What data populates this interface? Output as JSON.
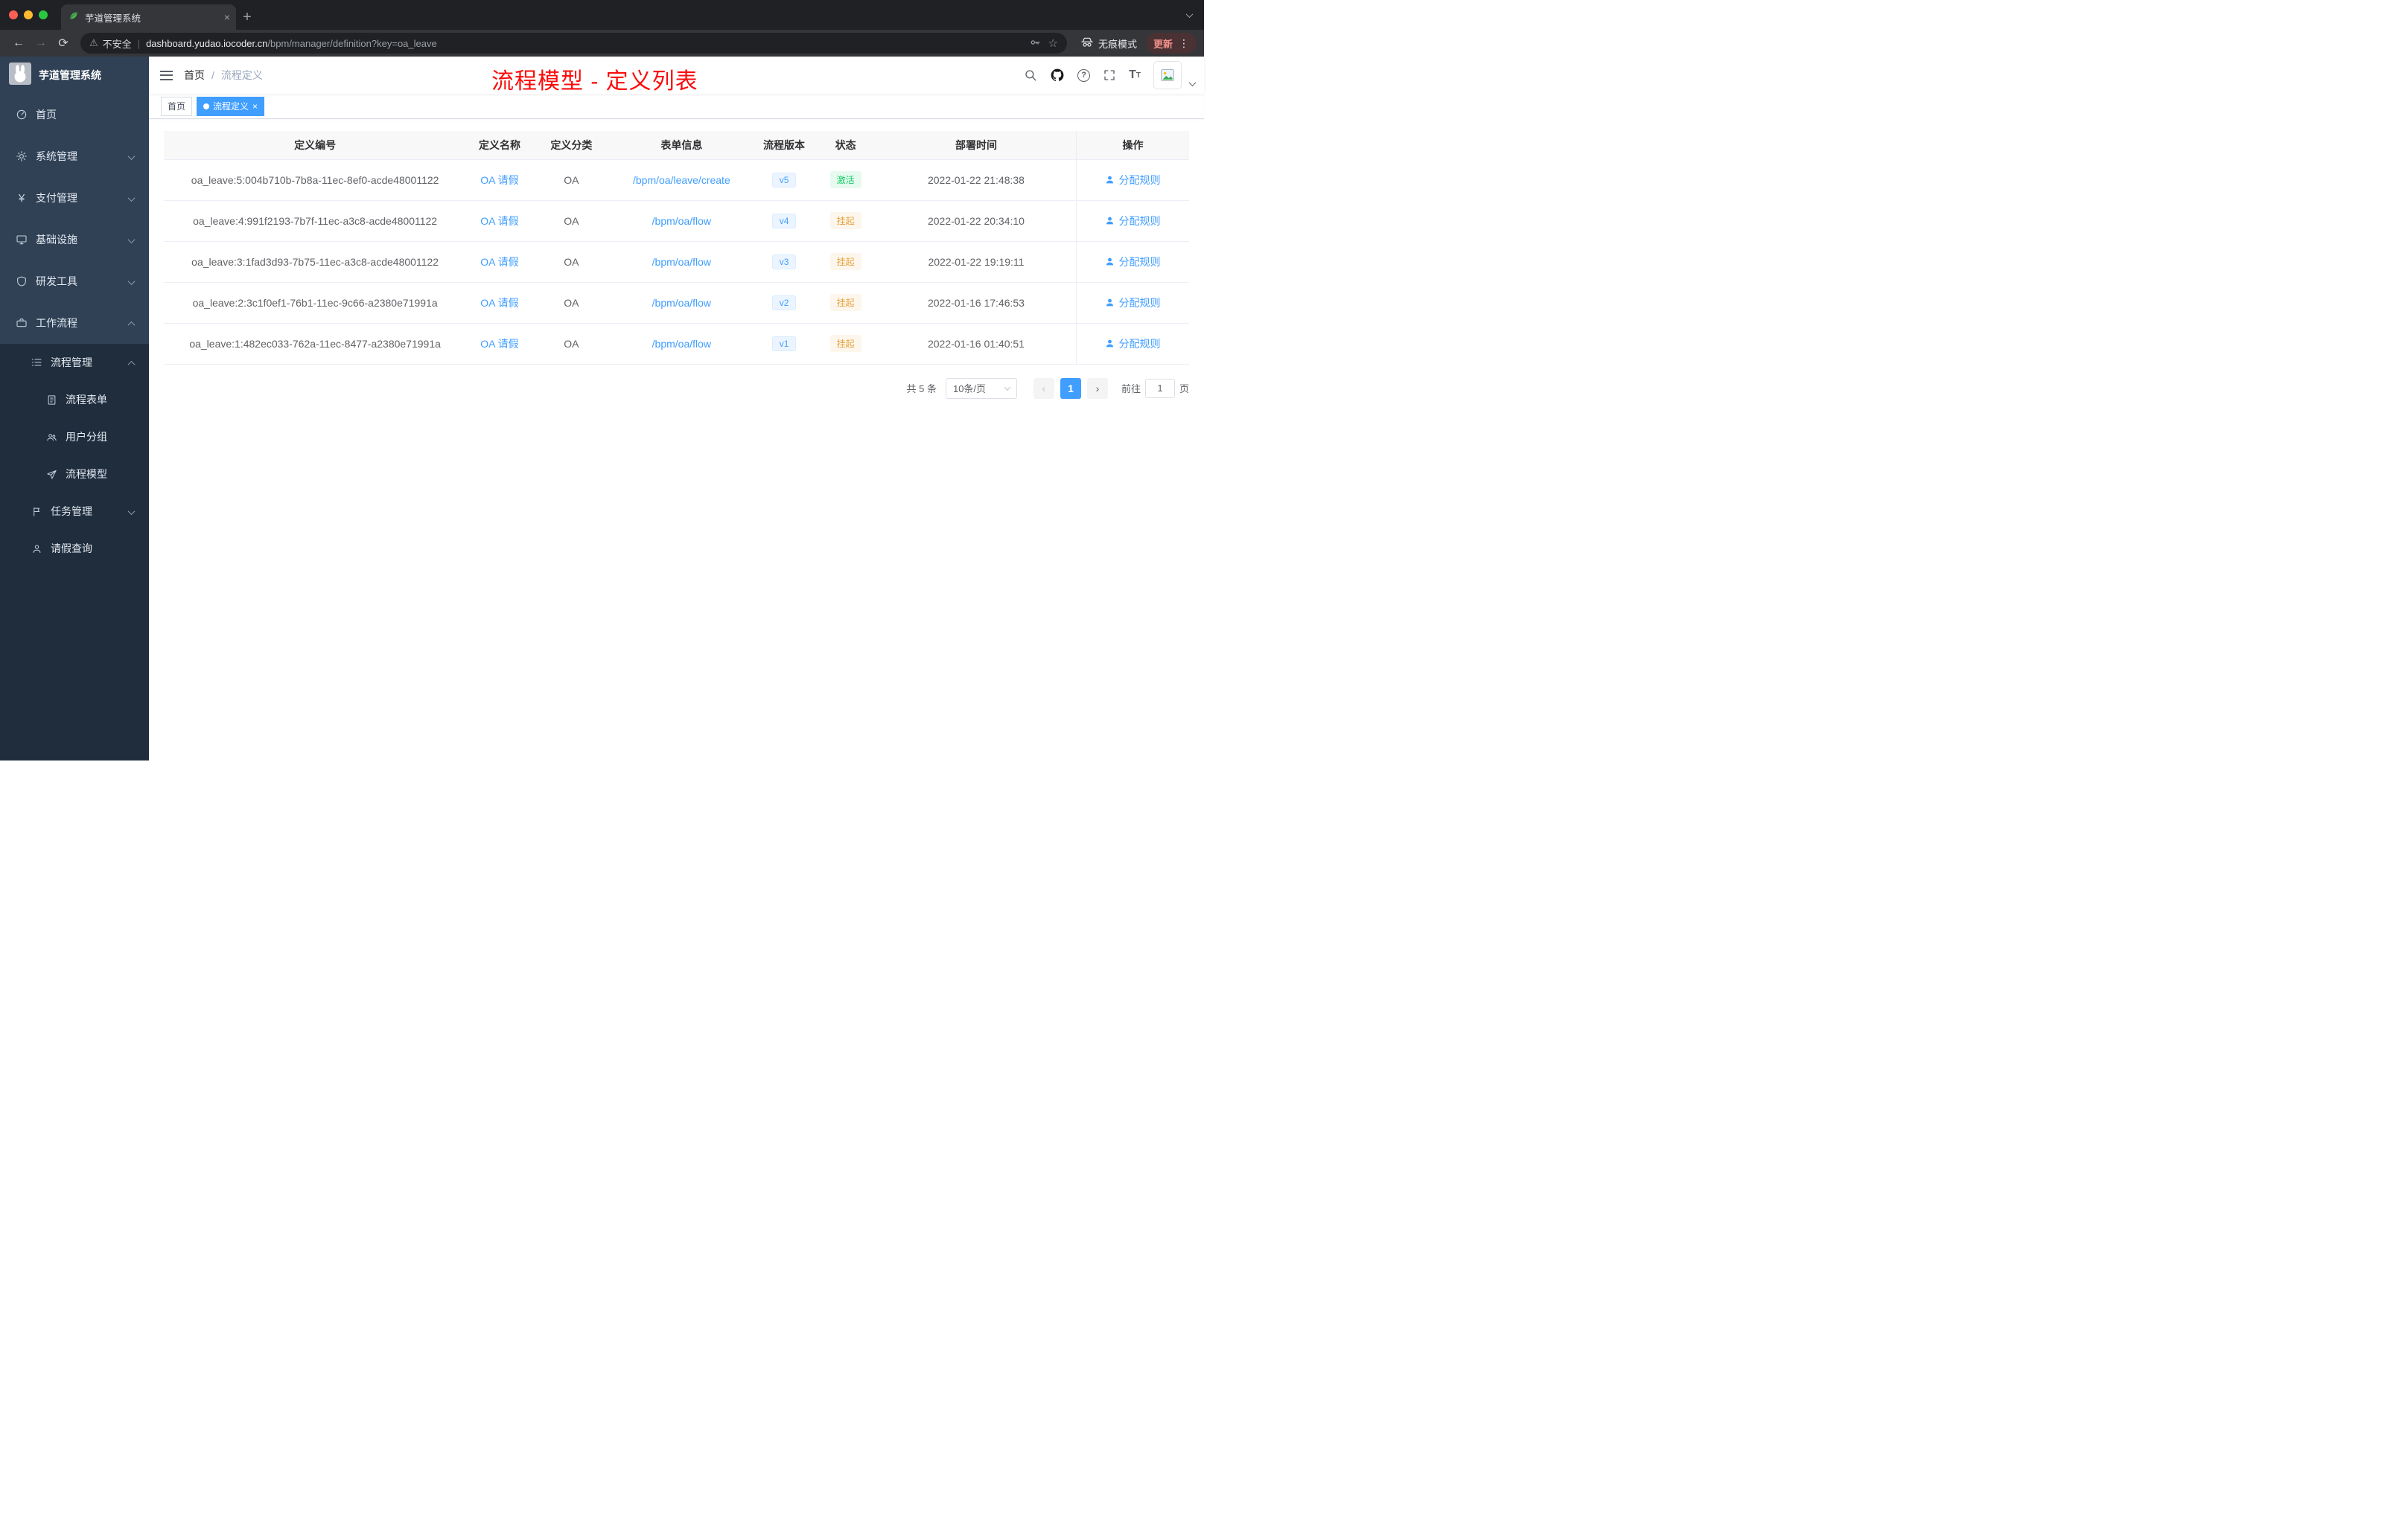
{
  "browser": {
    "tab_title": "芋道管理系统",
    "new_tab_icon": "+",
    "close_icon": "×",
    "back_icon": "←",
    "forward_icon": "→",
    "reload_icon": "⟳",
    "warning_icon": "⚠",
    "security_label": "不安全",
    "url_domain": "dashboard.yudao.iocoder.cn",
    "url_path": "/bpm/manager/definition?key=oa_leave",
    "star_icon": "☆",
    "incognito_label": "无痕模式",
    "update_label": "更新",
    "menu_icon": "⋮"
  },
  "sidebar": {
    "app_title": "芋道管理系统",
    "menu": [
      {
        "label": "首页"
      },
      {
        "label": "系统管理"
      },
      {
        "label": "支付管理"
      },
      {
        "label": "基础设施"
      },
      {
        "label": "研发工具"
      },
      {
        "label": "工作流程"
      },
      {
        "label": "流程管理"
      },
      {
        "label": "流程表单"
      },
      {
        "label": "用户分组"
      },
      {
        "label": "流程模型"
      },
      {
        "label": "任务管理"
      },
      {
        "label": "请假查询"
      }
    ]
  },
  "navbar": {
    "breadcrumb_home": "首页",
    "breadcrumb_sep": "/",
    "breadcrumb_current": "流程定义",
    "annotation": "流程模型 - 定义列表"
  },
  "tags": {
    "home": "首页",
    "active": "流程定义",
    "close_icon": "×"
  },
  "table": {
    "columns": [
      "定义编号",
      "定义名称",
      "定义分类",
      "表单信息",
      "流程版本",
      "状态",
      "部署时间",
      "操作"
    ],
    "rows": [
      {
        "id": "oa_leave:5:004b710b-7b8a-11ec-8ef0-acde48001122",
        "name": "OA 请假",
        "category": "OA",
        "form": "/bpm/oa/leave/create",
        "version": "v5",
        "status": "激活",
        "status_color": "#13ce66",
        "time": "2022-01-22 21:48:38",
        "action": "分配规则"
      },
      {
        "id": "oa_leave:4:991f2193-7b7f-11ec-a3c8-acde48001122",
        "name": "OA 请假",
        "category": "OA",
        "form": "/bpm/oa/flow",
        "version": "v4",
        "status": "挂起",
        "status_color": "#e6a23c",
        "time": "2022-01-22 20:34:10",
        "action": "分配规则"
      },
      {
        "id": "oa_leave:3:1fad3d93-7b75-11ec-a3c8-acde48001122",
        "name": "OA 请假",
        "category": "OA",
        "form": "/bpm/oa/flow",
        "version": "v3",
        "status": "挂起",
        "status_color": "#e6a23c",
        "time": "2022-01-22 19:19:11",
        "action": "分配规则"
      },
      {
        "id": "oa_leave:2:3c1f0ef1-76b1-11ec-9c66-a2380e71991a",
        "name": "OA 请假",
        "category": "OA",
        "form": "/bpm/oa/flow",
        "version": "v2",
        "status": "挂起",
        "status_color": "#e6a23c",
        "time": "2022-01-16 17:46:53",
        "action": "分配规则"
      },
      {
        "id": "oa_leave:1:482ec033-762a-11ec-8477-a2380e71991a",
        "name": "OA 请假",
        "category": "OA",
        "form": "/bpm/oa/flow",
        "version": "v1",
        "status": "挂起",
        "status_color": "#e6a23c",
        "time": "2022-01-16 01:40:51",
        "action": "分配规则"
      }
    ]
  },
  "pagination": {
    "total": "共 5 条",
    "page_size": "10条/页",
    "prev_icon": "‹",
    "page": "1",
    "next_icon": "›",
    "goto_label": "前往",
    "goto_value": "1",
    "unit": "页"
  },
  "colors": {
    "accent_blue": "#409eff",
    "annotation_red": "#fb0b0b",
    "sidebar_bg": "#304156",
    "submenu_bg": "#1f2d3d"
  }
}
